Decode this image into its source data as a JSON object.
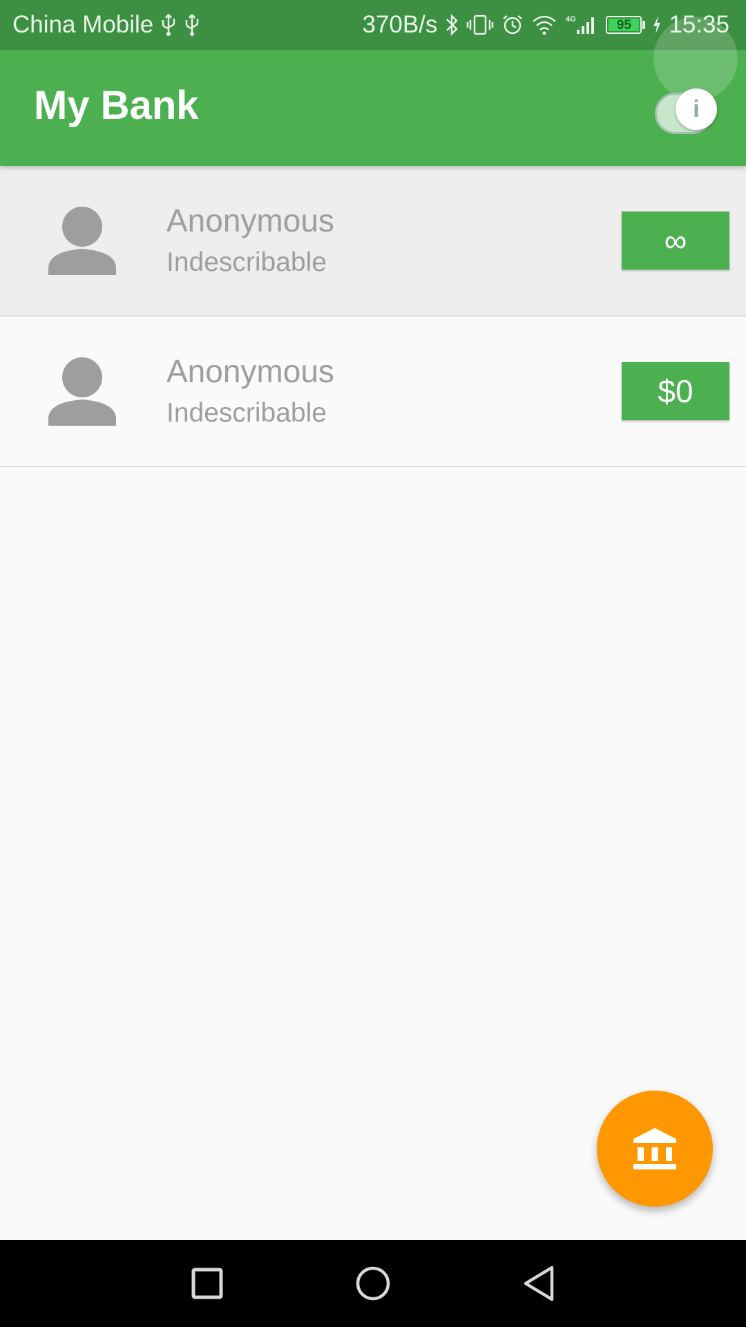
{
  "status_bar": {
    "carrier": "China Mobile",
    "net_speed": "370B/s",
    "battery_level": "95",
    "time": "15:35",
    "icons": [
      "usb-icon",
      "usb-icon",
      "bluetooth-icon",
      "vibrate-icon",
      "alarm-icon",
      "wifi-icon",
      "4g-signal-icon",
      "charging-icon"
    ]
  },
  "app_bar": {
    "title": "My Bank",
    "toggle_label": "i",
    "toggle_on": true
  },
  "accounts": [
    {
      "name": "Anonymous",
      "description": "Indescribable",
      "amount": "∞",
      "selected": true
    },
    {
      "name": "Anonymous",
      "description": "Indescribable",
      "amount": "$0",
      "selected": false
    }
  ],
  "fab": {
    "icon": "bank-icon"
  },
  "nav_bar": {
    "icons": [
      "recents-square-icon",
      "home-circle-icon",
      "back-triangle-icon"
    ]
  },
  "colors": {
    "status_bar": "#3d8f41",
    "primary": "#4caf50",
    "accent": "#ff9800",
    "text_secondary": "#9e9e9e",
    "selected_row": "#eeeeee",
    "background": "#fafafa"
  }
}
